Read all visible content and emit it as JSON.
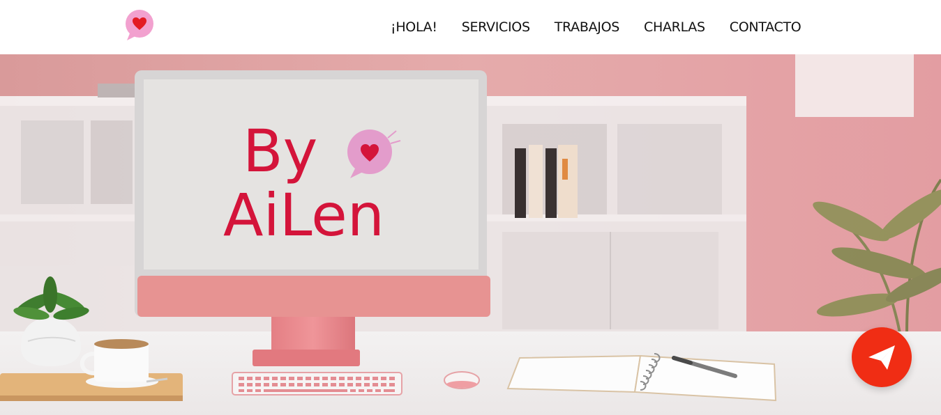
{
  "header": {
    "logo_icon": "heart-speech-bubble-icon",
    "nav": [
      {
        "label": "¡HOLA!"
      },
      {
        "label": "SERVICIOS"
      },
      {
        "label": "TRABAJOS"
      },
      {
        "label": "CHARLAS"
      },
      {
        "label": "CONTACTO"
      }
    ]
  },
  "hero": {
    "screen_logo_line1": "By",
    "screen_logo_line2": "AiLen",
    "logo_color": "#d4143a"
  },
  "fab": {
    "icon": "paper-plane-icon",
    "color": "#f02d14"
  },
  "colors": {
    "brand_pink": "#e891a6",
    "brand_red": "#e31b23",
    "wall_pink": "#e6a7a8"
  }
}
